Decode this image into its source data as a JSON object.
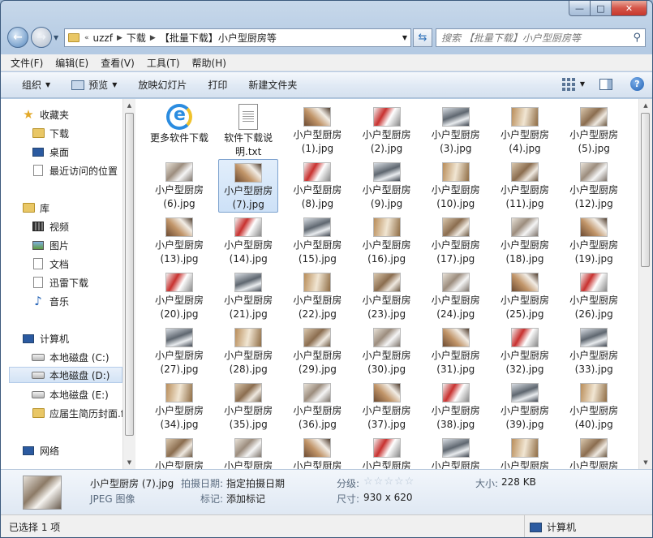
{
  "window": {
    "controls": {
      "minimize": "—",
      "maximize": "□",
      "close": "✕"
    }
  },
  "navigation": {
    "back_icon": "back-arrow-icon",
    "forward_icon": "forward-arrow-icon",
    "overflow_glyph": "«",
    "breadcrumbs": [
      "uzzf",
      "下载",
      "【批量下载】小户型厨房等"
    ],
    "search_placeholder": "搜索 【批量下载】小户型厨房等"
  },
  "menu": [
    "文件(F)",
    "编辑(E)",
    "查看(V)",
    "工具(T)",
    "帮助(H)"
  ],
  "commands": {
    "organize": "组织",
    "preview": "预览",
    "slideshow": "放映幻灯片",
    "print": "打印",
    "new_folder": "新建文件夹"
  },
  "sidebar": {
    "favorites": {
      "label": "收藏夹",
      "items": [
        "下载",
        "桌面",
        "最近访问的位置"
      ]
    },
    "libraries": {
      "label": "库",
      "items": [
        "视频",
        "图片",
        "文档",
        "迅雷下载",
        "音乐"
      ]
    },
    "computer": {
      "label": "计算机",
      "items": [
        "本地磁盘 (C:)",
        "本地磁盘 (D:)",
        "本地磁盘 (E:)",
        "应届生简历封面.f"
      ]
    },
    "network": {
      "label": "网络"
    },
    "selected": "本地磁盘 (D:)"
  },
  "files": [
    {
      "name": "更多软件下载",
      "icon": "ie-shortcut-icon"
    },
    {
      "name": "软件下载说明.txt",
      "icon": "text-file-icon"
    },
    {
      "name": "小户型厨房(1).jpg"
    },
    {
      "name": "小户型厨房(2).jpg"
    },
    {
      "name": "小户型厨房(3).jpg"
    },
    {
      "name": "小户型厨房(4).jpg"
    },
    {
      "name": "小户型厨房(5).jpg"
    },
    {
      "name": "小户型厨房(6).jpg"
    },
    {
      "name": "小户型厨房(7).jpg",
      "selected": true
    },
    {
      "name": "小户型厨房(8).jpg"
    },
    {
      "name": "小户型厨房(9).jpg"
    },
    {
      "name": "小户型厨房(10).jpg"
    },
    {
      "name": "小户型厨房(11).jpg"
    },
    {
      "name": "小户型厨房(12).jpg"
    },
    {
      "name": "小户型厨房(13).jpg"
    },
    {
      "name": "小户型厨房(14).jpg"
    },
    {
      "name": "小户型厨房(15).jpg"
    },
    {
      "name": "小户型厨房(16).jpg"
    },
    {
      "name": "小户型厨房(17).jpg"
    },
    {
      "name": "小户型厨房(18).jpg"
    },
    {
      "name": "小户型厨房(19).jpg"
    },
    {
      "name": "小户型厨房(20).jpg"
    },
    {
      "name": "小户型厨房(21).jpg"
    },
    {
      "name": "小户型厨房(22).jpg"
    },
    {
      "name": "小户型厨房(23).jpg"
    },
    {
      "name": "小户型厨房(24).jpg"
    },
    {
      "name": "小户型厨房(25).jpg"
    },
    {
      "name": "小户型厨房(26).jpg"
    },
    {
      "name": "小户型厨房(27).jpg"
    },
    {
      "name": "小户型厨房(28).jpg"
    },
    {
      "name": "小户型厨房(29).jpg"
    },
    {
      "name": "小户型厨房(30).jpg"
    },
    {
      "name": "小户型厨房(31).jpg"
    },
    {
      "name": "小户型厨房(32).jpg"
    },
    {
      "name": "小户型厨房(33).jpg"
    },
    {
      "name": "小户型厨房(34).jpg"
    },
    {
      "name": "小户型厨房(35).jpg"
    },
    {
      "name": "小户型厨房(36).jpg"
    },
    {
      "name": "小户型厨房(37).jpg"
    },
    {
      "name": "小户型厨房(38).jpg"
    },
    {
      "name": "小户型厨房(39).jpg"
    },
    {
      "name": "小户型厨房(40).jpg"
    },
    {
      "name": "小户型厨房"
    },
    {
      "name": "小户型厨房"
    },
    {
      "name": "小户型厨房"
    },
    {
      "name": "小户型厨房"
    },
    {
      "name": "小户型厨房"
    },
    {
      "name": "小户型厨房"
    },
    {
      "name": "小户型厨房"
    }
  ],
  "details": {
    "filename": "小户型厨房 (7).jpg",
    "filetype": "JPEG 图像",
    "date_label": "拍摄日期:",
    "date_value": "指定拍摄日期",
    "tags_label": "标记:",
    "tags_value": "添加标记",
    "rating_label": "分级:",
    "rating_stars": 0,
    "size_label": "大小:",
    "size_value": "228 KB",
    "dimensions_label": "尺寸:",
    "dimensions_value": "930 x 620"
  },
  "status": {
    "selection": "已选择 1 项",
    "location": "计算机"
  }
}
